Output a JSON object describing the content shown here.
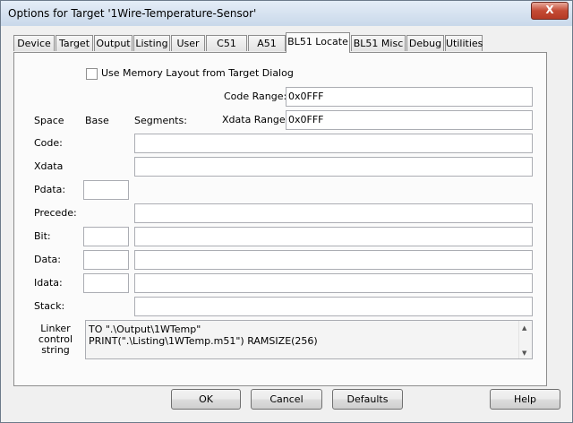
{
  "window": {
    "title": "Options for Target '1Wire-Temperature-Sensor'",
    "close_glyph": "X"
  },
  "tabs": [
    {
      "label": "Device"
    },
    {
      "label": "Target"
    },
    {
      "label": "Output"
    },
    {
      "label": "Listing"
    },
    {
      "label": "User"
    },
    {
      "label": "C51"
    },
    {
      "label": "A51"
    },
    {
      "label": "BL51 Locate",
      "active": true
    },
    {
      "label": "BL51 Misc"
    },
    {
      "label": "Debug"
    },
    {
      "label": "Utilities"
    }
  ],
  "form": {
    "use_memory_layout": {
      "label": "Use Memory Layout from Target Dialog",
      "checked": false
    },
    "code_range": {
      "label": "Code Range:",
      "value": "0x0FFF"
    },
    "xdata_range": {
      "label": "Xdata Range:",
      "value": "0x0FFF"
    },
    "headers": {
      "space": "Space",
      "base": "Base",
      "segments": "Segments:"
    },
    "rows": {
      "code": {
        "label": "Code:",
        "segments": ""
      },
      "xdata": {
        "label": "Xdata",
        "segments": ""
      },
      "pdata": {
        "label": "Pdata:",
        "base": ""
      },
      "precede": {
        "label": "Precede:",
        "segments": ""
      },
      "bit": {
        "label": "Bit:",
        "base": "",
        "segments": ""
      },
      "data": {
        "label": "Data:",
        "base": "",
        "segments": ""
      },
      "idata": {
        "label": "Idata:",
        "base": "",
        "segments": ""
      },
      "stack": {
        "label": "Stack:",
        "segments": ""
      }
    },
    "linker": {
      "label_lines": [
        "Linker",
        "control",
        "string"
      ],
      "lines": [
        "TO \".\\Output\\1WTemp\"",
        "PRINT(\".\\Listing\\1WTemp.m51\") RAMSIZE(256)"
      ]
    }
  },
  "buttons": {
    "ok": "OK",
    "cancel": "Cancel",
    "defaults": "Defaults",
    "help": "Help"
  }
}
